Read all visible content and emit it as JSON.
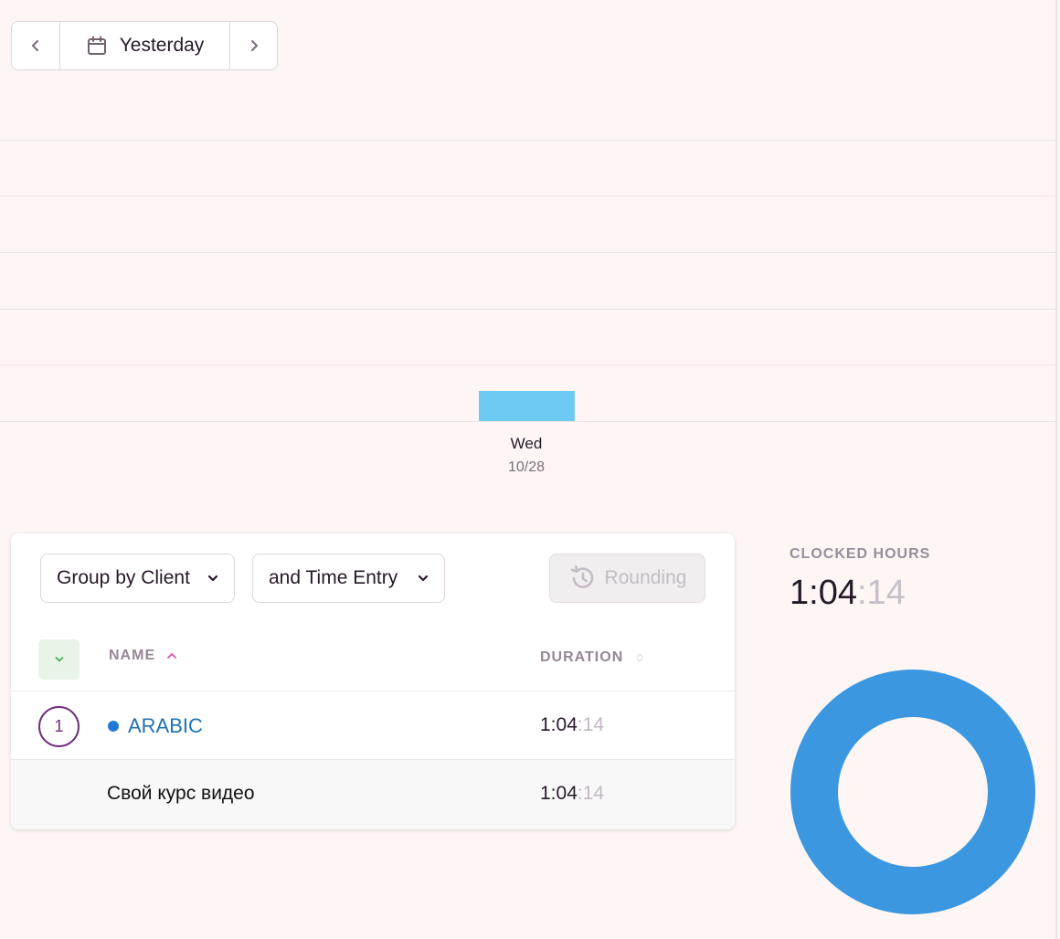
{
  "date_nav": {
    "label": "Yesterday",
    "prev_icon": "chevron-left-icon",
    "next_icon": "chevron-right-icon",
    "calendar_icon": "calendar-icon"
  },
  "chart_data": {
    "type": "bar",
    "categories": [
      "Wed"
    ],
    "category_dates": [
      "10/28"
    ],
    "values": [
      1.07
    ],
    "color": "#6dcaf3"
  },
  "card": {
    "group_by_label": "Group by Client",
    "sub_group_label": "and Time Entry",
    "rounding_label": "Rounding",
    "columns": {
      "name": "NAME",
      "duration": "DURATION"
    },
    "client_row": {
      "count": "1",
      "name": "ARABIC",
      "duration_main": "1:04",
      "duration_sec": ":14",
      "dot_color": "#1f7ad4"
    },
    "entry_row": {
      "name": "Свой курс видео",
      "duration_main": "1:04",
      "duration_sec": ":14"
    }
  },
  "summary": {
    "label": "CLOCKED HOURS",
    "value_main": "1:04",
    "value_sec": ":14",
    "donut_color": "#3a97e0",
    "donut_share": 1.0
  }
}
